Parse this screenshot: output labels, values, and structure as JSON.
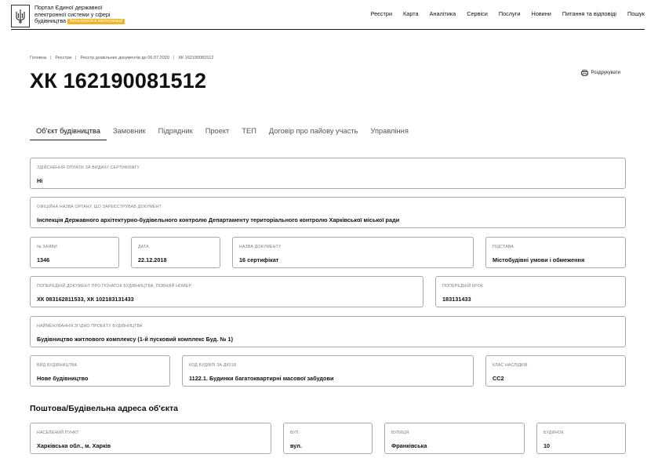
{
  "header": {
    "logo_line1": "Портал Єдиної державної",
    "logo_line2": "електронної системи у сфері",
    "logo_line3": "будівництва",
    "beta_badge": "Бета-версія в експлуатації",
    "nav": [
      "Реєстри",
      "Карта",
      "Аналітика",
      "Сервіси",
      "Послуги",
      "Новини",
      "Питання та відповіді",
      "Пошук"
    ]
  },
  "breadcrumb": [
    "Головна",
    "Реєстри",
    "Реєстр дозвільних документів до 06.07.2020",
    "ХК 162190081512"
  ],
  "page_title": "ХК 162190081512",
  "print_label": "Роздрукувати",
  "tabs": [
    "Об'єкт будівництва",
    "Замовник",
    "Підрядник",
    "Проект",
    "ТЕП",
    "Договір про пайову участь",
    "Управління"
  ],
  "fields": {
    "payment": {
      "label": "Здійснення оплати за видачу сертифікату",
      "value": "Ні"
    },
    "authority": {
      "label": "Офіційна назва органу, що зареєстрував документ",
      "value": "Інспекція Державного архітектурно-будівельного контролю Департаменту територіального контролю Харківської міської ради"
    },
    "app_no": {
      "label": "№ заяви",
      "value": "1346"
    },
    "date": {
      "label": "Дата",
      "value": "22.12.2018"
    },
    "doc_name": {
      "label": "Назва документу",
      "value": "16 сертифікат"
    },
    "basis": {
      "label": "Підстава",
      "value": "Містобудівні умови і обмеження"
    },
    "prev_doc": {
      "label": "Попередній документ про початок будівництва, повний номер",
      "value": "ХК 083162811533, ХК 102183131433"
    },
    "prev_step": {
      "label": "Попередній крок",
      "value": "183131433"
    },
    "project_name": {
      "label": "Найменування згідно проекту будівництва",
      "value": "Будівництво житлового комплексу (1-й пусковий комплекс Буд. № 1)"
    },
    "build_type": {
      "label": "Вид будівництва",
      "value": "Нове будівництво"
    },
    "dk018": {
      "label": "Код будівлі за ДК018",
      "value": "1122.1. Будинки багатоквартирні масової забудови"
    },
    "class": {
      "label": "Клас наслідків",
      "value": "СС2"
    }
  },
  "address_section_title": "Поштова/Будівельна адреса об'єкта",
  "address": {
    "locality": {
      "label": "Населений пункт",
      "value": "Харківська обл., м. Харків"
    },
    "street_type": {
      "label": "Вул.",
      "value": "вул."
    },
    "street": {
      "label": "Вулиця",
      "value": "Франківська"
    },
    "building": {
      "label": "Будинок",
      "value": "10"
    }
  }
}
